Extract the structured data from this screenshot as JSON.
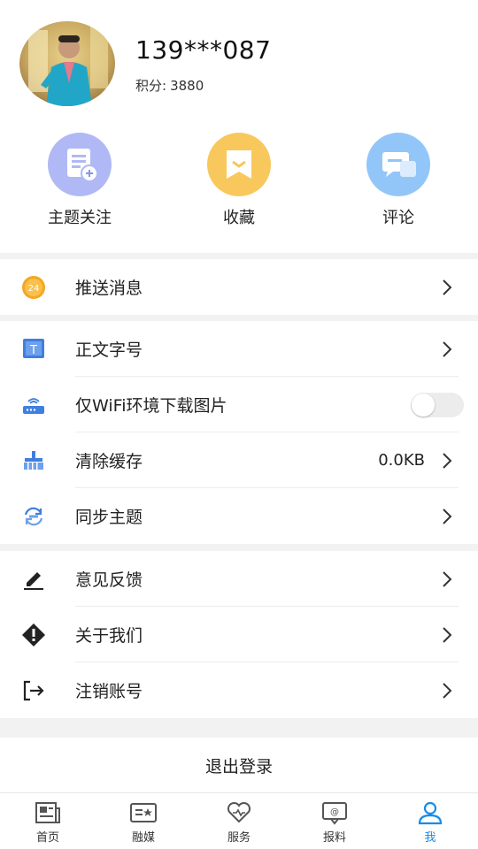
{
  "profile": {
    "phone": "139***087",
    "points_label": "积分:",
    "points_value": "3880"
  },
  "quick_actions": [
    {
      "label": "主题关注",
      "icon": "topic-follow-icon",
      "color": "#a9b4f5"
    },
    {
      "label": "收藏",
      "icon": "bookmark-icon",
      "color": "#f6c65f"
    },
    {
      "label": "评论",
      "icon": "comment-icon",
      "color": "#8ec3f7"
    }
  ],
  "menu": {
    "push": {
      "label": "推送消息",
      "icon": "push-24-icon"
    },
    "font_size": {
      "label": "正文字号",
      "icon": "font-size-icon"
    },
    "wifi_images": {
      "label": "仅WiFi环境下载图片",
      "icon": "router-icon",
      "enabled": false
    },
    "clear_cache": {
      "label": "清除缓存",
      "value": "0.0KB",
      "icon": "broom-icon"
    },
    "sync_theme": {
      "label": "同步主题",
      "icon": "sync-icon"
    },
    "feedback": {
      "label": "意见反馈",
      "icon": "pencil-icon"
    },
    "about": {
      "label": "关于我们",
      "icon": "info-diamond-icon"
    },
    "deregister": {
      "label": "注销账号",
      "icon": "exit-icon"
    }
  },
  "logout_label": "退出登录",
  "tabs": [
    {
      "label": "首页",
      "icon": "newspaper-icon",
      "active": false
    },
    {
      "label": "融媒",
      "icon": "media-icon",
      "active": false
    },
    {
      "label": "服务",
      "icon": "heart-service-icon",
      "active": false
    },
    {
      "label": "报料",
      "icon": "report-icon",
      "active": false
    },
    {
      "label": "我",
      "icon": "user-icon",
      "active": true
    }
  ],
  "colors": {
    "accent": "#1a8be6",
    "icon_blue": "#3f7fe0"
  }
}
